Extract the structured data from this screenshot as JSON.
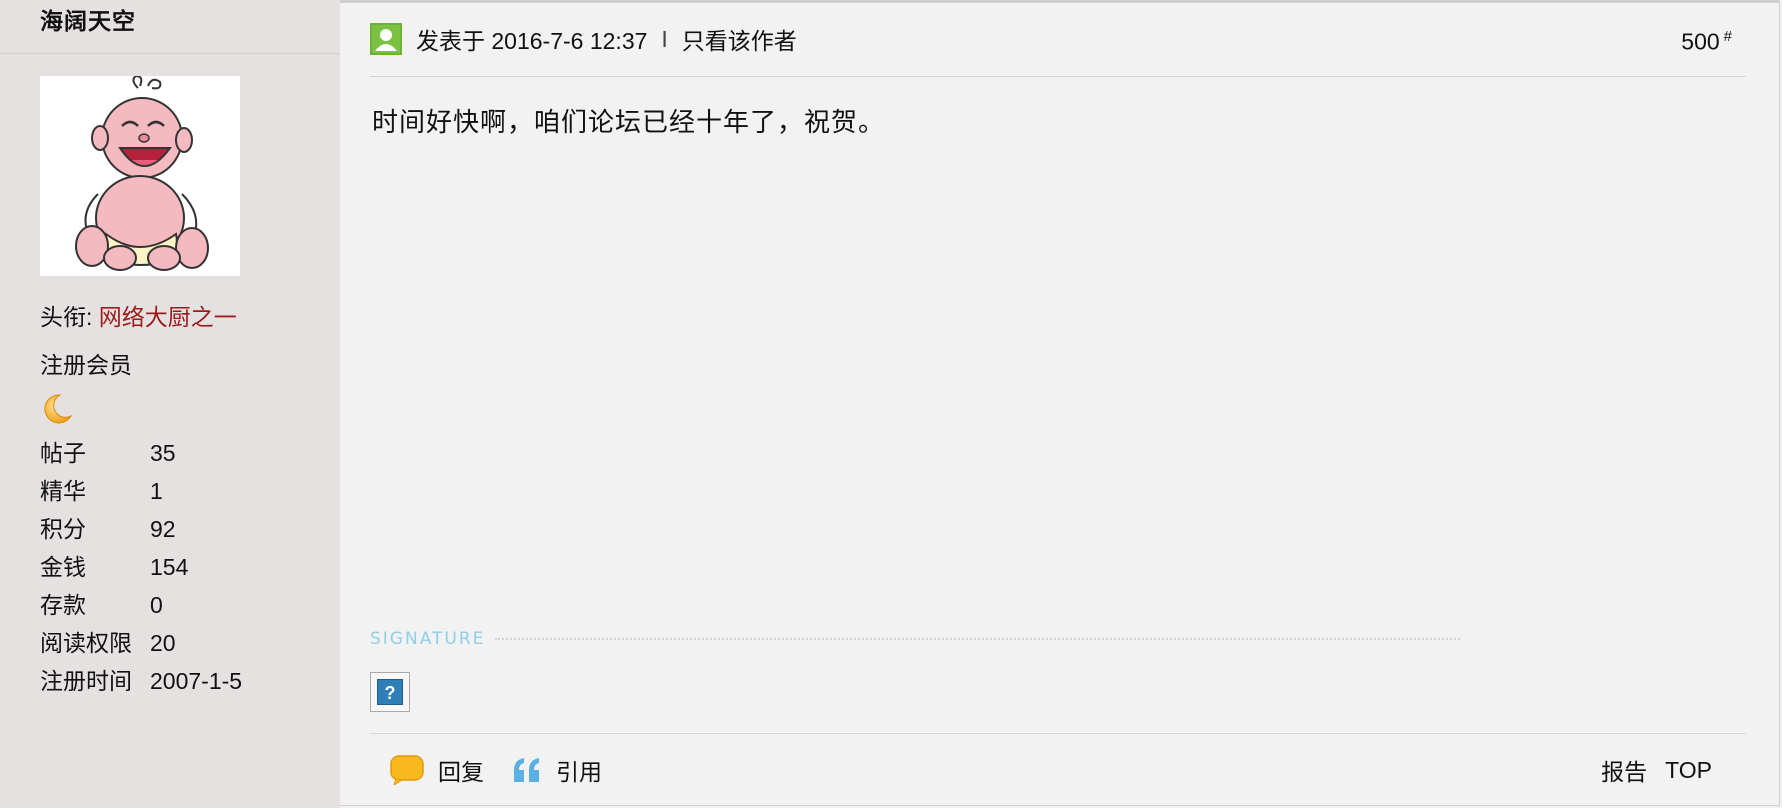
{
  "author": {
    "username": "海阔天空",
    "title_label": "头衔:",
    "title_value": "网络大厨之一",
    "group": "注册会员",
    "stats": [
      {
        "label": "帖子",
        "value": "35"
      },
      {
        "label": "精华",
        "value": "1"
      },
      {
        "label": "积分",
        "value": "92"
      },
      {
        "label": "金钱",
        "value": "154"
      },
      {
        "label": "存款",
        "value": "0"
      },
      {
        "label": "阅读权限",
        "value": "20"
      },
      {
        "label": "注册时间",
        "value": "2007-1-5"
      }
    ],
    "avatar_icon": "baby-cartoon-avatar",
    "rank_icon": "moon-icon"
  },
  "post": {
    "posted_at": "发表于 2016-7-6 12:37",
    "separator": "I",
    "only_author": "只看该作者",
    "floor": "500",
    "floor_mark": "#",
    "body": "时间好快啊，咱们论坛已经十年了，祝贺。",
    "signature_label": "SIGNATURE",
    "signature_image": "?"
  },
  "actions": {
    "reply": "回复",
    "quote": "引用",
    "report": "报告",
    "top": "TOP"
  },
  "colors": {
    "sidebar_bg": "#e6e1e1",
    "main_bg": "#f2f2f2",
    "title_red": "#9b1b1b",
    "signature_blue": "#8ed0e6",
    "online_green": "#7cc242"
  }
}
